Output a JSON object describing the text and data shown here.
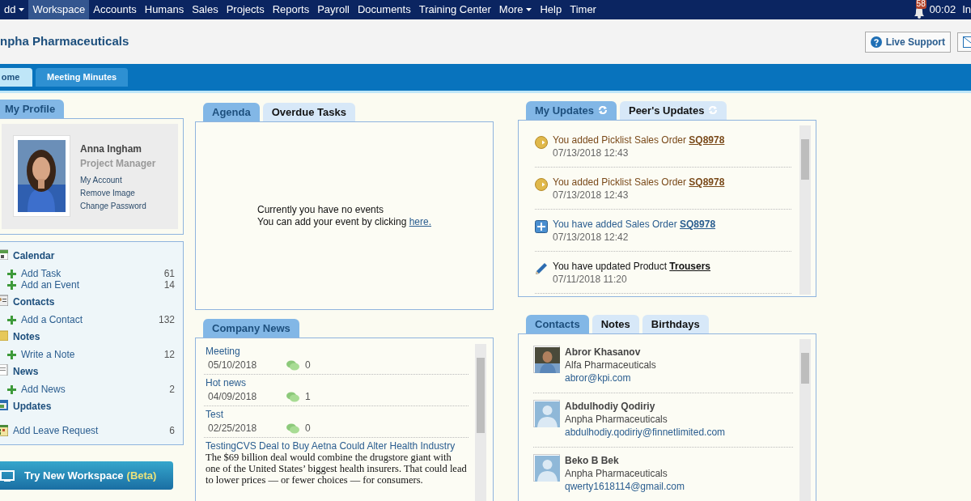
{
  "top_nav": {
    "items": [
      {
        "label": "dd",
        "dropdown": true,
        "selected": false
      },
      {
        "label": "Workspace",
        "dropdown": false,
        "selected": true
      },
      {
        "label": "Accounts",
        "dropdown": false,
        "selected": false
      },
      {
        "label": "Humans",
        "dropdown": false,
        "selected": false
      },
      {
        "label": "Sales",
        "dropdown": false,
        "selected": false
      },
      {
        "label": "Projects",
        "dropdown": false,
        "selected": false
      },
      {
        "label": "Reports",
        "dropdown": false,
        "selected": false
      },
      {
        "label": "Payroll",
        "dropdown": false,
        "selected": false
      },
      {
        "label": "Documents",
        "dropdown": false,
        "selected": false
      },
      {
        "label": "Training Center",
        "dropdown": false,
        "selected": false
      },
      {
        "label": "More",
        "dropdown": true,
        "selected": false
      },
      {
        "label": "Help",
        "dropdown": false,
        "selected": false
      },
      {
        "label": "Timer",
        "dropdown": false,
        "selected": false
      }
    ],
    "notification_count": "58",
    "time": "00:02",
    "user": "In"
  },
  "header": {
    "company": "npha Pharmaceuticals",
    "live_support": "Live Support"
  },
  "page_tabs": [
    {
      "label": "ome",
      "selected": true
    },
    {
      "label": "Meeting Minutes",
      "selected": false
    }
  ],
  "profile": {
    "tab": "My Profile",
    "name": "Anna Ingham",
    "role": "Project Manager",
    "links": [
      "My Account",
      "Remove Image",
      "Change Password"
    ]
  },
  "sidebar": [
    {
      "kind": "section",
      "label": "Calendar"
    },
    {
      "kind": "action",
      "label": "Add Task",
      "count": "61"
    },
    {
      "kind": "action",
      "label": "Add an Event",
      "count": "14"
    },
    {
      "kind": "section",
      "label": "Contacts"
    },
    {
      "kind": "action",
      "label": "Add a Contact",
      "count": "132"
    },
    {
      "kind": "section",
      "label": "Notes"
    },
    {
      "kind": "action",
      "label": "Write a Note",
      "count": "12"
    },
    {
      "kind": "section",
      "label": "News"
    },
    {
      "kind": "action",
      "label": "Add News",
      "count": "2"
    },
    {
      "kind": "section",
      "label": "Updates"
    },
    {
      "kind": "leave",
      "label": "Add Leave Request",
      "count": "6"
    }
  ],
  "workspace_button": {
    "label": "Try New Workspace",
    "beta": "(Beta)"
  },
  "agenda": {
    "tabs": [
      {
        "label": "Agenda",
        "selected": true
      },
      {
        "label": "Overdue Tasks",
        "selected": false
      }
    ],
    "message": "Currently you have no events",
    "prompt": "You can add your event by clicking",
    "link": "here."
  },
  "company_news": {
    "tab": "Company News",
    "items": [
      {
        "title": "Meeting",
        "date": "05/10/2018",
        "comments": "0"
      },
      {
        "title": "Hot news",
        "date": "04/09/2018",
        "comments": "1"
      },
      {
        "title": "Test",
        "date": "02/25/2018",
        "comments": "0"
      },
      {
        "title": "TestingCVS Deal to Buy Aetna Could Alter Health Industry",
        "body": "The $69 billion deal would combine the drugstore giant with one of the United States’ biggest health insurers. That could lead to lower prices — or fewer choices — for consumers."
      }
    ]
  },
  "updates": {
    "tabs": [
      {
        "label": "My Updates",
        "selected": true
      },
      {
        "label": "Peer's Updates",
        "selected": false
      }
    ],
    "items": [
      {
        "kind": "picklist",
        "text": "You added Picklist Sales Order",
        "link": "SQ8978",
        "time": "07/13/2018 12:43"
      },
      {
        "kind": "picklist",
        "text": "You added Picklist Sales Order",
        "link": "SQ8978",
        "time": "07/13/2018 12:43"
      },
      {
        "kind": "added",
        "text": "You have added Sales Order",
        "link": "SQ8978",
        "time": "07/13/2018 12:42"
      },
      {
        "kind": "updated",
        "text": "You have updated Product",
        "link": "Trousers",
        "time": "07/11/2018 11:20"
      }
    ]
  },
  "contacts": {
    "tabs": [
      {
        "label": "Contacts",
        "selected": true
      },
      {
        "label": "Notes",
        "selected": false
      },
      {
        "label": "Birthdays",
        "selected": false
      }
    ],
    "items": [
      {
        "name": "Abror Khasanov",
        "company": "Alfa Pharmaceuticals",
        "email": "abror@kpi.com",
        "has_photo": true
      },
      {
        "name": "Abdulhodiy Qodiriy",
        "company": "Anpha Pharmaceuticals",
        "email": "abdulhodiy.qodiriy@finnetlimited.com",
        "has_photo": false
      },
      {
        "name": "Beko B Bek",
        "company": "Anpha Pharmaceuticals",
        "email": "qwerty1618114@gmail.com",
        "has_photo": false
      }
    ]
  }
}
